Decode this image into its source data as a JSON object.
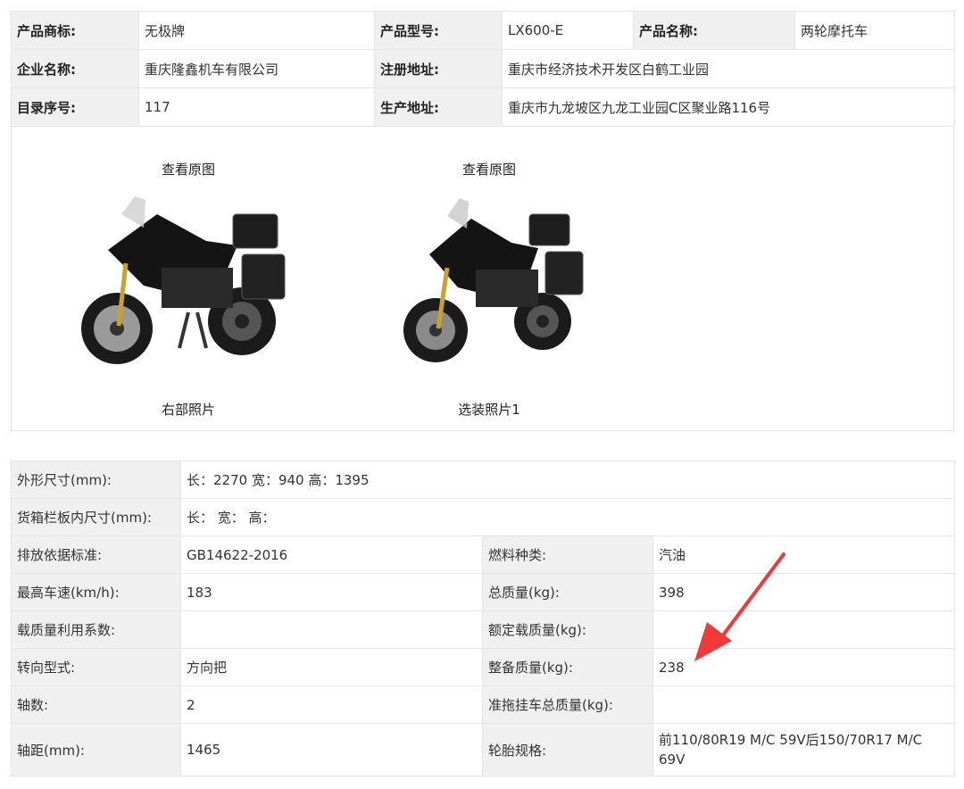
{
  "info": {
    "rows": [
      [
        {
          "label": "产品商标:",
          "value": "无极牌"
        },
        {
          "label": "产品型号:",
          "value": "LX600-E"
        },
        {
          "label": "产品名称:",
          "value": "两轮摩托车"
        }
      ],
      [
        {
          "label": "企业名称:",
          "value": "重庆隆鑫机车有限公司"
        },
        {
          "label": "注册地址:",
          "value": "重庆市经济技术开发区白鹤工业园"
        }
      ],
      [
        {
          "label": "目录序号:",
          "value": "117"
        },
        {
          "label": "生产地址:",
          "value": "重庆市九龙坡区九龙工业园C区聚业路116号"
        }
      ]
    ]
  },
  "photos": [
    {
      "link": "查看原图",
      "caption": "右部照片"
    },
    {
      "link": "查看原图",
      "caption": "选装照片1"
    }
  ],
  "params": {
    "rows": [
      {
        "l1": "外形尺寸(mm):",
        "v1": "长：2270 宽：940 高：1395"
      },
      {
        "l1": "货箱栏板内尺寸(mm):",
        "v1": "长：  宽：  高："
      },
      {
        "l1": "排放依据标准:",
        "v1": "GB14622-2016",
        "l2": "燃料种类:",
        "v2": "汽油"
      },
      {
        "l1": "最高车速(km/h):",
        "v1": "183",
        "l2": "总质量(kg):",
        "v2": "398"
      },
      {
        "l1": "载质量利用系数:",
        "v1": "",
        "l2": "额定载质量(kg):",
        "v2": ""
      },
      {
        "l1": "转向型式:",
        "v1": "方向把",
        "l2": "整备质量(kg):",
        "v2": "238"
      },
      {
        "l1": "轴数:",
        "v1": "2",
        "l2": "准拖挂车总质量(kg):",
        "v2": ""
      },
      {
        "l1": "轴距(mm):",
        "v1": "1465",
        "l2": "轮胎规格:",
        "v2": "前110/80R19 M/C 59V后150/70R17 M/C 69V"
      }
    ]
  },
  "colors": {
    "arrow": "#f03a3a",
    "label_bg": "#f0f0f0",
    "border": "#e6e6e6"
  }
}
